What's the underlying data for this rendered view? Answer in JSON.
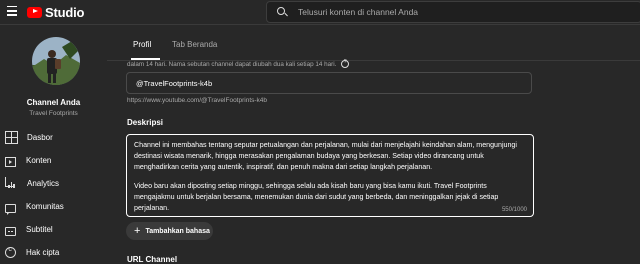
{
  "app": {
    "logo_text": "Studio"
  },
  "search": {
    "placeholder": "Telusuri konten di channel Anda"
  },
  "channel": {
    "name": "Channel Anda",
    "subtitle": "Travel Footprints"
  },
  "sidebar": {
    "items": [
      {
        "label": "Dasbor",
        "icon": "dashboard-icon"
      },
      {
        "label": "Konten",
        "icon": "content-icon"
      },
      {
        "label": "Analytics",
        "icon": "analytics-icon"
      },
      {
        "label": "Komunitas",
        "icon": "community-icon"
      },
      {
        "label": "Subtitel",
        "icon": "subtitles-icon"
      },
      {
        "label": "Hak cipta",
        "icon": "copyright-icon"
      }
    ]
  },
  "tabs": [
    {
      "label": "Profil",
      "active": true
    },
    {
      "label": "Tab Beranda",
      "active": false
    }
  ],
  "handle": {
    "note": "dalam 14 hari. Nama sebutan channel dapat diubah dua kali setiap 14 hari.",
    "value": "@TravelFootprints-k4b",
    "url": "https://www.youtube.com/@TravelFootprints-k4b"
  },
  "description": {
    "label": "Deskripsi",
    "paragraph1": "Channel ini membahas tentang seputar petualangan dan perjalanan, mulai dari menjelajahi keindahan alam, mengunjungi destinasi wisata menarik, hingga merasakan pengalaman budaya yang berkesan. Setiap video dirancang untuk menghadirkan cerita yang autentik, inspiratif, dan penuh makna dari setiap langkah perjalanan.",
    "paragraph2": "Video baru akan diposting setiap minggu, sehingga selalu ada kisah baru yang bisa kamu ikuti. Travel Footprints mengajakmu untuk berjalan bersama, menemukan dunia dari sudut yang berbeda, dan meninggalkan jejak di setiap perjalanan.",
    "counter": "550/1000"
  },
  "add_language": {
    "label": "Tambahkan bahasa"
  },
  "url_section": {
    "label": "URL Channel"
  },
  "colors": {
    "background": "#282828",
    "accent_red": "#ff0000",
    "text_secondary": "#aaaaaa"
  }
}
